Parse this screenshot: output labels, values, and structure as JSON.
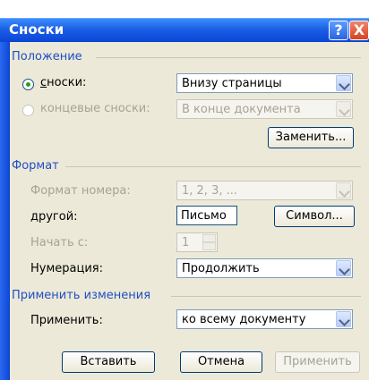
{
  "window": {
    "title": "Сноски",
    "help_label": "?",
    "close_label": "X"
  },
  "position": {
    "group_label": "Положение",
    "footnotes_label": "сноски:",
    "footnotes_value": "Внизу страницы",
    "endnotes_label": "концевые сноски:",
    "endnotes_value": "В конце документа",
    "replace_button": "Заменить..."
  },
  "format": {
    "group_label": "Формат",
    "number_format_label": "Формат номера:",
    "number_format_value": "1, 2, 3, ...",
    "other_label": "другой:",
    "other_value": "Письмо",
    "symbol_button": "Символ...",
    "start_label": "Начать с:",
    "start_value": "1",
    "numbering_label": "Нумерация:",
    "numbering_value": "Продолжить"
  },
  "apply": {
    "group_label": "Применить изменения",
    "apply_label": "Применить:",
    "apply_value": "ко всему документу"
  },
  "buttons": {
    "insert": "Вставить",
    "cancel": "Отмена",
    "apply": "Применить"
  },
  "colors": {
    "group_label": "#1f4fc6",
    "titlebar": "#0a45d6",
    "dialog_bg": "#ece9d8",
    "close_button": "#d8421f"
  }
}
